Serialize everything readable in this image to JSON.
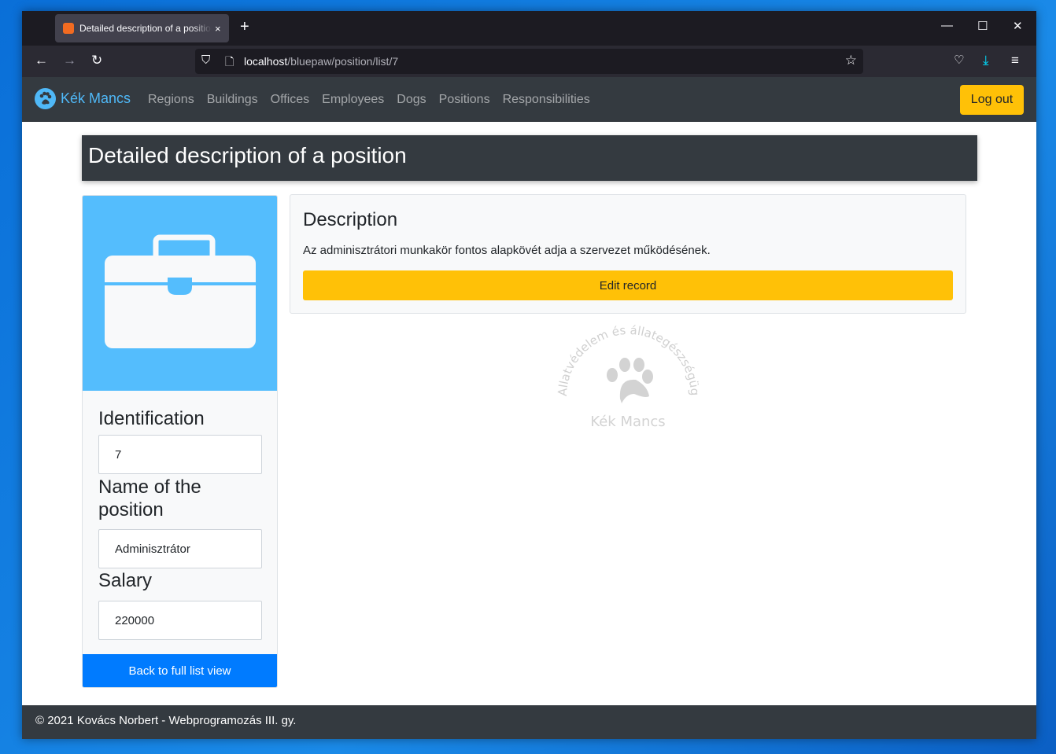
{
  "browser": {
    "tab_title": "Detailed description of a position",
    "url_host": "localhost",
    "url_path": "/bluepaw/position/list/7",
    "new_tab": "+",
    "tab_close": "×"
  },
  "nav": {
    "brand": "Kék Mancs",
    "links": [
      "Regions",
      "Buildings",
      "Offices",
      "Employees",
      "Dogs",
      "Positions",
      "Responsibilities"
    ],
    "logout": "Log out"
  },
  "page": {
    "title": "Detailed description of a position"
  },
  "side": {
    "icon": "briefcase-icon",
    "identification_label": "Identification",
    "identification_value": "7",
    "name_label": "Name of the position",
    "name_value": "Adminisztrátor",
    "salary_label": "Salary",
    "salary_value": "220000",
    "back_button": "Back to full list view"
  },
  "description": {
    "heading": "Description",
    "text": "Az adminisztrátori munkakör fontos alapkövét adja a szervezet működésének.",
    "edit_button": "Edit record"
  },
  "watermark": {
    "arc_text": "Állatvédelem és állategészségügy",
    "name": "Kék Mancs"
  },
  "footer": {
    "text": "© 2021 Kovács Norbert - Webprogramozás III. gy."
  },
  "colors": {
    "accent": "#54bdfd",
    "warning": "#ffc107",
    "primary": "#007bff",
    "navbar": "#343a40"
  }
}
